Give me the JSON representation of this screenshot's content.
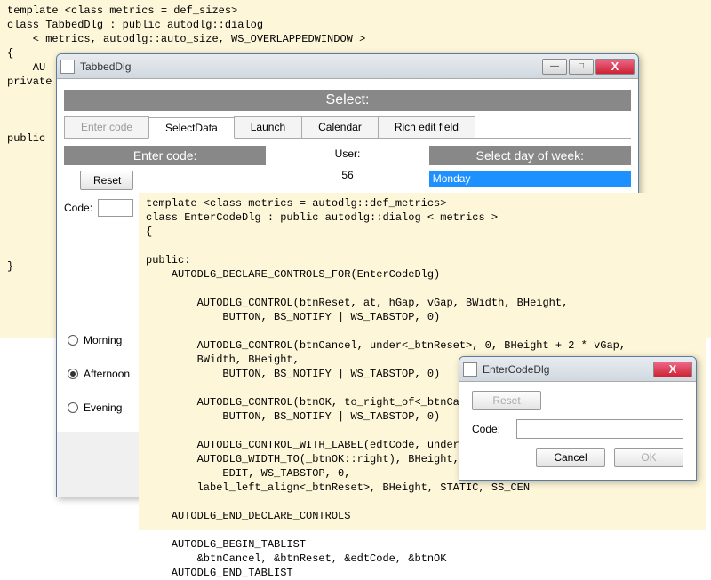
{
  "code1": "template <class metrics = def_sizes>\nclass TabbedDlg : public autodlg::dialog\n    < metrics, autodlg::auto_size, WS_OVERLAPPEDWINDOW >\n{\n    AU\nprivate\n\n\n\npublic\n\n                                                                                                 0)\n\n\n\n\n        AUTO\n\n}",
  "code2": "template <class metrics = autodlg::def_metrics>\nclass EnterCodeDlg : public autodlg::dialog < metrics >\n{\n\npublic:\n    AUTODLG_DECLARE_CONTROLS_FOR(EnterCodeDlg)\n\n        AUTODLG_CONTROL(btnReset, at, hGap, vGap, BWidth, BHeight,\n            BUTTON, BS_NOTIFY | WS_TABSTOP, 0)\n\n        AUTODLG_CONTROL(btnCancel, under<_btnReset>, 0, BHeight + 2 * vGap,\n        BWidth, BHeight,\n            BUTTON, BS_NOTIFY | WS_TABSTOP, 0)\n\n        AUTODLG_CONTROL(btnOK, to_right_of<_btnCancel>, hGap\n            BUTTON, BS_NOTIFY | WS_TABSTOP, 0)\n\n        AUTODLG_CONTROL_WITH_LABEL(edtCode, under<_btnReset>\n        AUTODLG_WIDTH_TO(_btnOK::right), BHeight,\n            EDIT, WS_TABSTOP, 0,\n        label_left_align<_btnReset>, BHeight, STATIC, SS_CEN\n\n    AUTODLG_END_DECLARE_CONTROLS\n\n    AUTODLG_BEGIN_TABLIST\n        &btnCancel, &btnReset, &edtCode, &btnOK\n    AUTODLG_END_TABLIST",
  "tabbedDlg": {
    "title": "TabbedDlg",
    "selectHeader": "Select:",
    "tabs": [
      "Enter code",
      "SelectData",
      "Launch",
      "Calendar",
      "Rich edit field"
    ],
    "activeTab": 1,
    "enterCodeHeader": "Enter code:",
    "userLabel": "User:",
    "userValue": "56",
    "dayHeader": "Select day of week:",
    "daySelected": "Monday",
    "resetBtn": "Reset",
    "codeLabel": "Code:",
    "radios": [
      "Morning",
      "Afternoon",
      "Evening"
    ],
    "radioChecked": 1
  },
  "enterCodeDlg": {
    "title": "EnterCodeDlg",
    "resetBtn": "Reset",
    "codeLabel": "Code:",
    "cancelBtn": "Cancel",
    "okBtn": "OK"
  },
  "winCtrl": {
    "min": "—",
    "max": "□",
    "close": "X"
  }
}
